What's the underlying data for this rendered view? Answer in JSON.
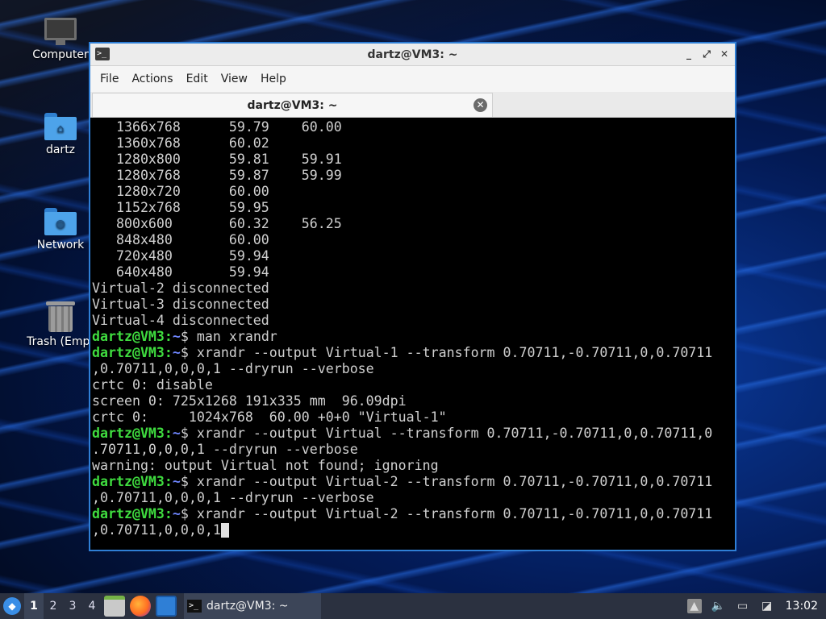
{
  "desktop": {
    "icons": [
      {
        "label": "Computer",
        "icon": "computer-icon"
      },
      {
        "label": "dartz",
        "icon": "home-folder-icon"
      },
      {
        "label": "Network",
        "icon": "network-folder-icon"
      },
      {
        "label": "Trash (Empt",
        "icon": "trash-icon"
      }
    ]
  },
  "window": {
    "title": "dartz@VM3: ~",
    "controls": {
      "minimize": "_",
      "maximize": "⤢",
      "close": "✕"
    },
    "menu": [
      "File",
      "Actions",
      "Edit",
      "View",
      "Help"
    ],
    "tab": {
      "label": "dartz@VM3: ~",
      "close": "✕"
    }
  },
  "terminal": {
    "prompt_user": "dartz@VM3:",
    "prompt_path": "~",
    "prompt_symbol": "$",
    "lines": [
      {
        "kind": "out",
        "text": "   1366x768      59.79    60.00"
      },
      {
        "kind": "out",
        "text": "   1360x768      60.02"
      },
      {
        "kind": "out",
        "text": "   1280x800      59.81    59.91"
      },
      {
        "kind": "out",
        "text": "   1280x768      59.87    59.99"
      },
      {
        "kind": "out",
        "text": "   1280x720      60.00"
      },
      {
        "kind": "out",
        "text": "   1152x768      59.95"
      },
      {
        "kind": "out",
        "text": "   800x600       60.32    56.25"
      },
      {
        "kind": "out",
        "text": "   848x480       60.00"
      },
      {
        "kind": "out",
        "text": "   720x480       59.94"
      },
      {
        "kind": "out",
        "text": "   640x480       59.94"
      },
      {
        "kind": "out",
        "text": "Virtual-2 disconnected"
      },
      {
        "kind": "out",
        "text": "Virtual-3 disconnected"
      },
      {
        "kind": "out",
        "text": "Virtual-4 disconnected"
      },
      {
        "kind": "cmd",
        "text": " man xrandr"
      },
      {
        "kind": "cmd",
        "text": " xrandr --output Virtual-1 --transform 0.70711,-0.70711,0,0.70711"
      },
      {
        "kind": "out",
        "text": ",0.70711,0,0,0,1 --dryrun --verbose"
      },
      {
        "kind": "out",
        "text": "crtc 0: disable"
      },
      {
        "kind": "out",
        "text": "screen 0: 725x1268 191x335 mm  96.09dpi"
      },
      {
        "kind": "out",
        "text": "crtc 0:     1024x768  60.00 +0+0 \"Virtual-1\""
      },
      {
        "kind": "cmd",
        "text": " xrandr --output Virtual --transform 0.70711,-0.70711,0,0.70711,0"
      },
      {
        "kind": "out",
        "text": ".70711,0,0,0,1 --dryrun --verbose"
      },
      {
        "kind": "out",
        "text": "warning: output Virtual not found; ignoring"
      },
      {
        "kind": "cmd",
        "text": " xrandr --output Virtual-2 --transform 0.70711,-0.70711,0,0.70711"
      },
      {
        "kind": "out",
        "text": ",0.70711,0,0,0,1 --dryrun --verbose"
      },
      {
        "kind": "cmd",
        "text": " xrandr --output Virtual-2 --transform 0.70711,-0.70711,0,0.70711"
      },
      {
        "kind": "input",
        "text": ",0.70711,0,0,0,1"
      }
    ]
  },
  "taskbar": {
    "workspaces": [
      "1",
      "2",
      "3",
      "4"
    ],
    "active_workspace": "1",
    "task_label": "dartz@VM3: ~",
    "clock": "13:02"
  },
  "colors": {
    "prompt_green": "#3fdc3f",
    "path_blue": "#6f86ff",
    "window_border": "#2f7fd6"
  }
}
